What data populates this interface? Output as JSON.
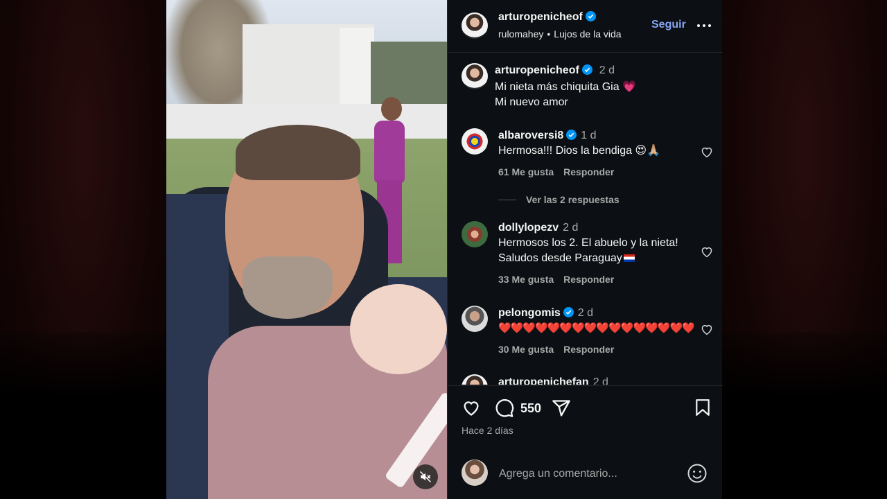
{
  "post": {
    "username": "arturopenicheof",
    "audio_user": "rulomahey",
    "audio_title": "Lujos de la vida",
    "follow_label": "Seguir",
    "caption_time": "2 d",
    "caption_line1": "Mi nieta más chiquita Gia 💗",
    "caption_line2": "Mi nuevo amor"
  },
  "comments": [
    {
      "username": "albaroversi8",
      "time": "1 d",
      "text": "Hermosa!!! Dios la bendiga 😍🙏🏼",
      "likes": "61 Me gusta",
      "reply": "Responder",
      "replies_label": "Ver las 2 respuestas"
    },
    {
      "username": "dollylopezv",
      "time": "2 d",
      "text_line1": "Hermosos los 2. El abuelo y la nieta!",
      "text_line2": "Saludos desde Paraguay",
      "likes": "33 Me gusta",
      "reply": "Responder"
    },
    {
      "username": "pelongomis",
      "time": "2 d",
      "text": "❤️❤️❤️❤️❤️❤️❤️❤️❤️❤️❤️❤️❤️❤️❤️❤️",
      "likes": "30 Me gusta",
      "reply": "Responder"
    },
    {
      "username": "arturopenichefan",
      "time": "2 d"
    }
  ],
  "actions": {
    "comment_count": "550",
    "posted": "Hace 2 días"
  },
  "composer": {
    "placeholder": "Agrega un comentario..."
  },
  "colors": {
    "panel_bg": "#0c1014",
    "accent_follow": "#85a6f3",
    "verified": "#0095f6",
    "muted_text": "#a8a8a8"
  }
}
